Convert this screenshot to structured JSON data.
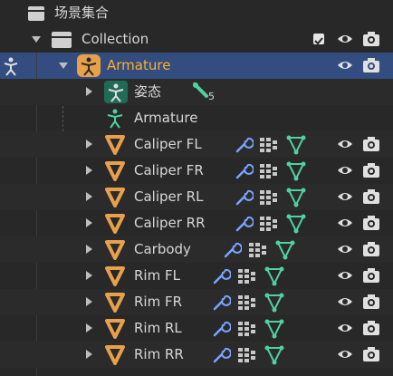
{
  "outliner": {
    "scene_collection_label": "场景集合",
    "collection_label": "Collection",
    "armature_label": "Armature",
    "pose_label": "姿态",
    "bone_count": "5",
    "armature_data_label": "Armature",
    "objects": [
      {
        "label": "Caliper FL"
      },
      {
        "label": "Caliper FR"
      },
      {
        "label": "Caliper RL"
      },
      {
        "label": "Caliper RR"
      },
      {
        "label": "Carbody"
      },
      {
        "label": "Rim FL"
      },
      {
        "label": "Rim FR"
      },
      {
        "label": "Rim RL"
      },
      {
        "label": "Rim RR"
      }
    ]
  },
  "colors": {
    "background": "#282828",
    "selected_row": "#334d80",
    "active_text": "#ffaf29",
    "mesh_icon": "#e8a04a",
    "armature_icon": "#4fd1a1",
    "modifier_icon": "#7aa5ff",
    "mesh_data_icon": "#4fd1a1"
  }
}
